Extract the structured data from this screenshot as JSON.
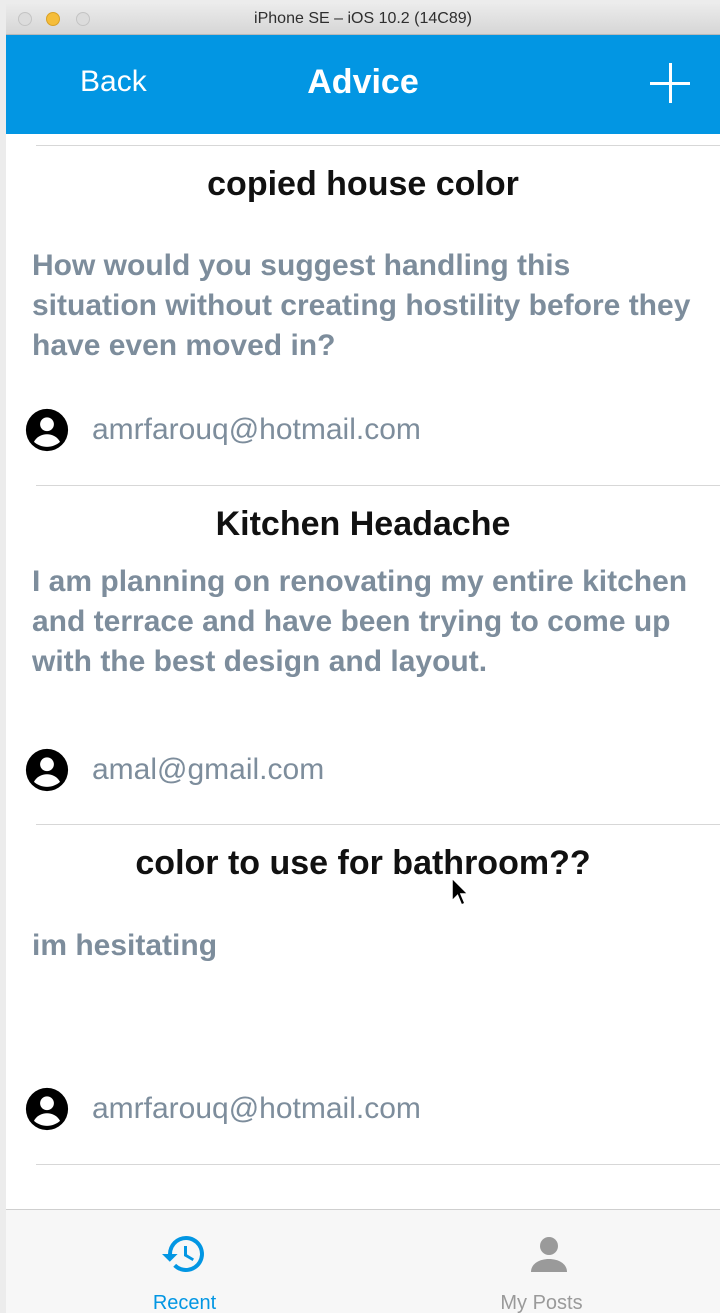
{
  "window": {
    "title": "iPhone SE – iOS 10.2 (14C89)"
  },
  "navbar": {
    "back_label": "Back",
    "title": "Advice",
    "add_icon": "plus-icon"
  },
  "posts": [
    {
      "title": "copied house color",
      "body": "How would you suggest handling this situation without creating hostility before they have even moved in?",
      "author": "amrfarouq@hotmail.com"
    },
    {
      "title": "Kitchen Headache",
      "body": "I am planning on renovating my entire kitchen and terrace and have been trying to come up with the best design and layout.",
      "author": "amal@gmail.com"
    },
    {
      "title": "color to use for bathroom??",
      "body": "im hesitating",
      "author": "amrfarouq@hotmail.com"
    }
  ],
  "tabbar": {
    "tabs": [
      {
        "label": "Recent",
        "icon": "history-icon",
        "active": true
      },
      {
        "label": "My Posts",
        "icon": "person-icon",
        "active": false
      }
    ]
  },
  "colors": {
    "accent": "#0296e3",
    "body_text": "#7d8d9c",
    "inactive_tab": "#9a9a9a"
  }
}
